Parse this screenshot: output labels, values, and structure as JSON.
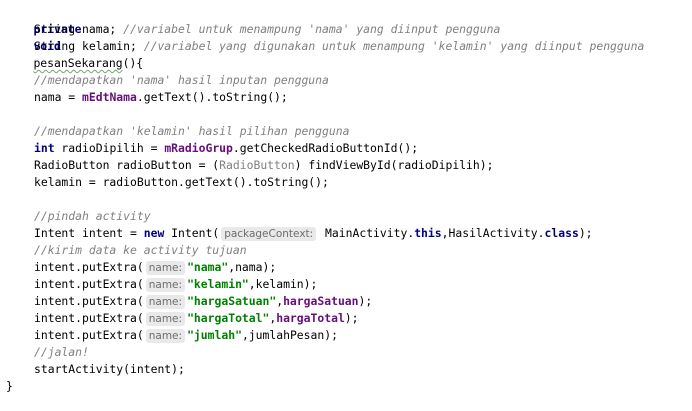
{
  "code": {
    "l1": {
      "kw1": "private",
      "kw2": "void",
      "name": "pesanSekarang",
      "rest": "(){"
    },
    "l2": {
      "text": "String nama; ",
      "comment": "//variabel untuk menampung 'nama' yang diinput pengguna"
    },
    "l3": {
      "text": "String kelamin; ",
      "comment": "//variabel yang digunakan untuk menampung 'kelamin' yang diinput pengguna"
    },
    "l5": {
      "comment": "//mendapatkan 'nama' hasil inputan pengguna"
    },
    "l6": {
      "a": "nama = ",
      "field": "mEdtNama",
      "b": ".getText().toString();"
    },
    "l8": {
      "comment": "//mendapatkan 'kelamin' hasil pilihan pengguna"
    },
    "l9": {
      "kw": "int",
      "a": " radioDipilih = ",
      "field": "mRadioGrup",
      "b": ".getCheckedRadioButtonId();"
    },
    "l10": {
      "a": "RadioButton radioButton = (",
      "cast": "RadioButton",
      "b": ") findViewById(radioDipilih);"
    },
    "l11": {
      "text": "kelamin = radioButton.getText().toString();"
    },
    "l13": {
      "comment": "//pindah activity"
    },
    "l14": {
      "a": "Intent intent = ",
      "kw": "new",
      "b": " Intent(",
      "hint": "packageContext:",
      "c": " MainActivity.",
      "kw2": "this",
      "d": ",HasilActivity.",
      "kw3": "class",
      "e": ");"
    },
    "l15": {
      "comment": "//kirim data ke activity tujuan"
    },
    "extras": [
      {
        "pre": "intent.putExtra(",
        "hint": "name:",
        "str": "\"nama\"",
        "post": ",nama);"
      },
      {
        "pre": "intent.putExtra(",
        "hint": "name:",
        "str": "\"kelamin\"",
        "post": ",kelamin);"
      },
      {
        "pre": "intent.putExtra(",
        "hint": "name:",
        "str": "\"hargaSatuan\"",
        "post": ",",
        "field": "hargaSatuan",
        "tail": ");"
      },
      {
        "pre": "intent.putExtra(",
        "hint": "name:",
        "str": "\"hargaTotal\"",
        "post": ",",
        "field": "hargaTotal",
        "tail": ");"
      },
      {
        "pre": "intent.putExtra(",
        "hint": "name:",
        "str": "\"jumlah\"",
        "post": ",jumlahPesan);"
      }
    ],
    "l21": {
      "comment": "//jalan!"
    },
    "l22": {
      "text": "startActivity(intent);"
    },
    "l23": {
      "text": "}"
    }
  }
}
